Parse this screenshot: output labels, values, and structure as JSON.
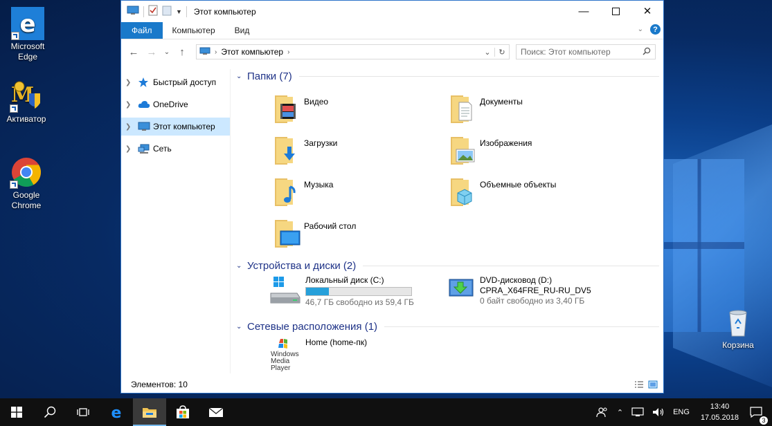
{
  "desktop": {
    "icons": [
      {
        "label": "Microsoft\nEdge"
      },
      {
        "label": "Активатор"
      },
      {
        "label": "Google\nChrome"
      },
      {
        "label": "Корзина"
      }
    ]
  },
  "window": {
    "title": "Этот компьютер",
    "tabs": {
      "file": "Файл",
      "computer": "Компьютер",
      "view": "Вид"
    },
    "address": {
      "root_arrow": "›",
      "location": "Этот компьютер"
    },
    "search": {
      "placeholder": "Поиск: Этот компьютер"
    },
    "nav": [
      {
        "label": "Быстрый доступ"
      },
      {
        "label": "OneDrive"
      },
      {
        "label": "Этот компьютер"
      },
      {
        "label": "Сеть"
      }
    ],
    "groups": {
      "folders": "Папки (7)",
      "devices": "Устройства и диски (2)",
      "network": "Сетевые расположения (1)"
    },
    "folders": [
      {
        "label": "Видео"
      },
      {
        "label": "Документы"
      },
      {
        "label": "Загрузки"
      },
      {
        "label": "Изображения"
      },
      {
        "label": "Музыка"
      },
      {
        "label": "Объемные объекты"
      },
      {
        "label": "Рабочий стол"
      }
    ],
    "drives": [
      {
        "name": "Локальный диск (C:)",
        "free": "46,7 ГБ свободно из 59,4 ГБ",
        "used_fraction": 0.214
      },
      {
        "name": "DVD-дисковод (D:)",
        "volume": "CPRA_X64FRE_RU-RU_DV5",
        "free": "0 байт свободно из 3,40 ГБ"
      }
    ],
    "network_locations": [
      {
        "label": "Home (home-пк)",
        "logo_text": "Windows Media Player"
      }
    ],
    "status": "Элементов: 10"
  },
  "taskbar": {
    "tray": {
      "lang": "ENG",
      "time": "13:40",
      "date": "17.05.2018",
      "notifications": "3"
    }
  },
  "colors": {
    "accent": "#1979ca",
    "progress": "#26a0da",
    "group_header": "#1e3287",
    "selection": "#cce8ff"
  }
}
